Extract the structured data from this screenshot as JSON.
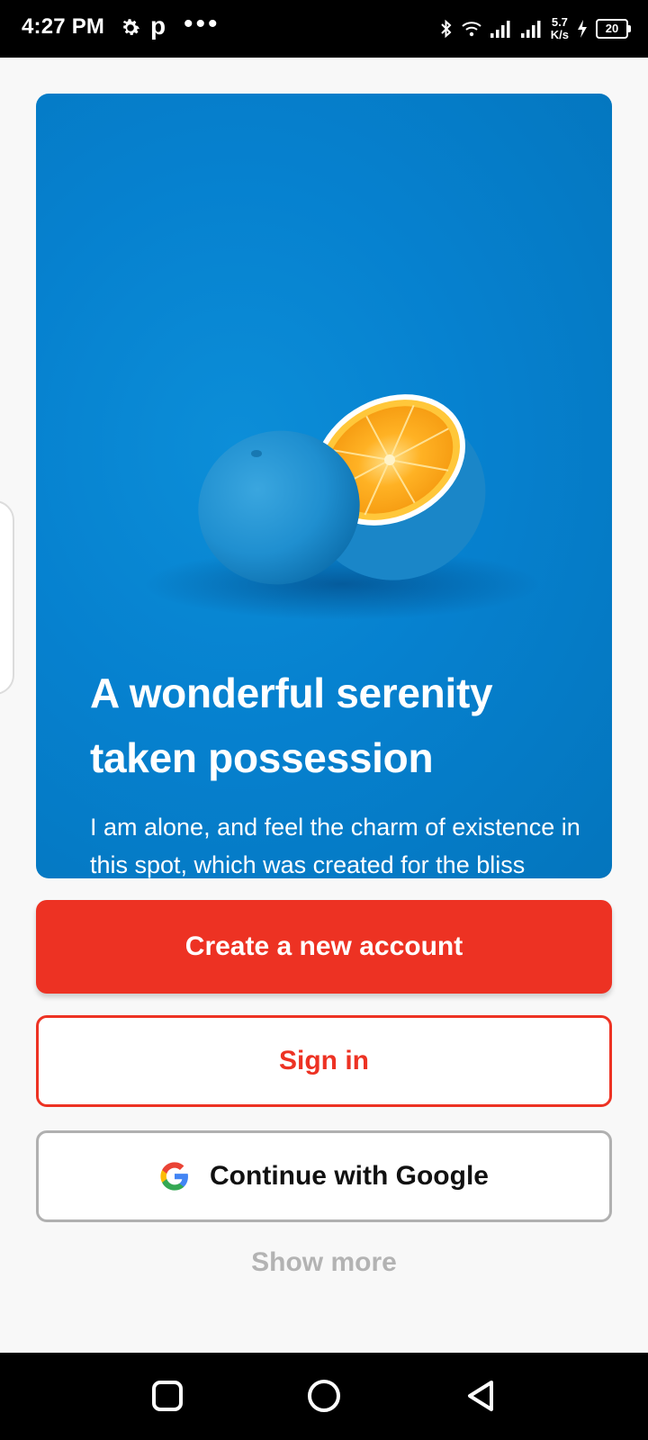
{
  "status_bar": {
    "time": "4:27 PM",
    "app_letter": "p",
    "more_dots": "•••",
    "net_speed_value": "5.7",
    "net_speed_unit": "K/s",
    "battery_level": "20",
    "icons": [
      "gear-icon",
      "bluetooth-icon",
      "wifi-icon",
      "signal-icon",
      "signal-icon",
      "charging-icon",
      "battery-icon"
    ]
  },
  "hero": {
    "title": "A wonderful serenity taken possession",
    "subtitle": "I am alone, and feel the charm of existence in this spot, which was created for the bliss",
    "colors": {
      "background": "#0681cf",
      "orange_flesh": "#ffa21c"
    }
  },
  "actions": {
    "create_account_label": "Create a new account",
    "sign_in_label": "Sign in",
    "google_label": "Continue with Google",
    "show_more_label": "Show more"
  },
  "colors": {
    "accent": "#ed3223",
    "google_border": "#b0b0b0",
    "muted_text": "#b3b3b3"
  },
  "nav_bar": {
    "icons": [
      "recents-square-icon",
      "home-circle-icon",
      "back-triangle-icon"
    ]
  }
}
